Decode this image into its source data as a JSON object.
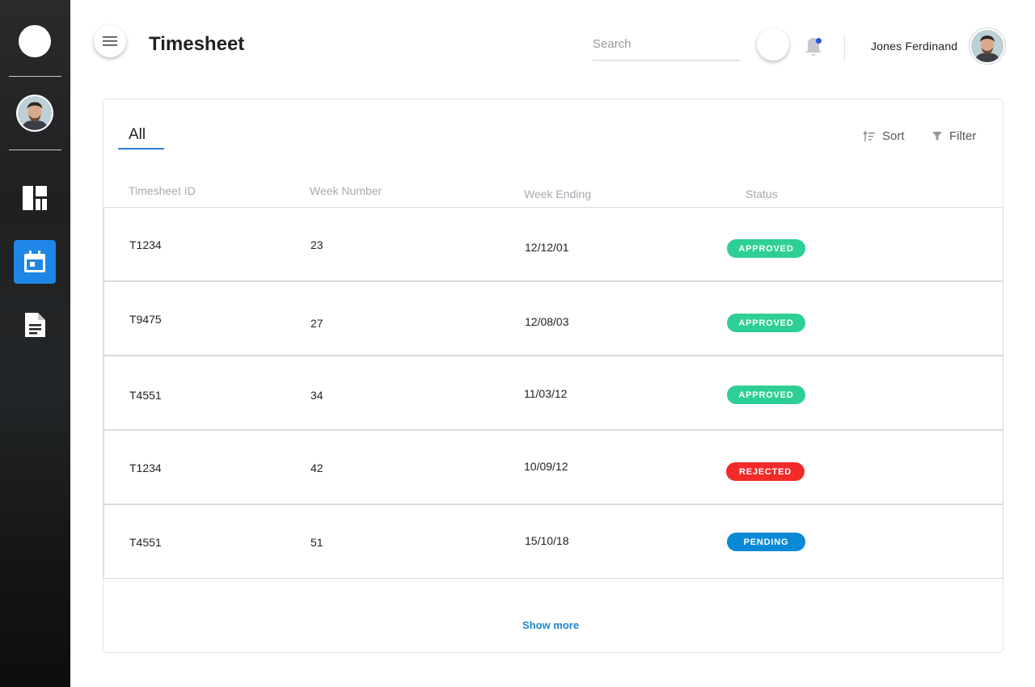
{
  "header": {
    "title": "Timesheet",
    "search_placeholder": "Search",
    "user_name": "Jones Ferdinand"
  },
  "sidebar": {
    "items": [
      {
        "icon": "dashboard-icon",
        "active": false
      },
      {
        "icon": "calendar-icon",
        "active": true
      },
      {
        "icon": "document-icon",
        "active": false
      }
    ]
  },
  "tabs": [
    {
      "label": "All",
      "active": true
    }
  ],
  "toolbar": {
    "sort_label": "Sort",
    "filter_label": "Filter"
  },
  "table": {
    "columns": [
      "Timesheet ID",
      "Week Number",
      "Week Ending",
      "Status"
    ],
    "rows": [
      {
        "id": "T1234",
        "week": "23",
        "ending": "12/12/01",
        "status": "APPROVED"
      },
      {
        "id": "T9475",
        "week": "27",
        "ending": "12/08/03",
        "status": "APPROVED"
      },
      {
        "id": "T4551",
        "week": "34",
        "ending": "11/03/12",
        "status": "APPROVED"
      },
      {
        "id": "T1234",
        "week": "42",
        "ending": "10/09/12",
        "status": "REJECTED"
      },
      {
        "id": "T4551",
        "week": "51",
        "ending": "15/10/18",
        "status": "PENDING"
      }
    ]
  },
  "show_more": "Show more",
  "colors": {
    "accent": "#1e86e6",
    "approved": "#2ecf94",
    "rejected": "#f22a2a",
    "pending": "#0a8ad6"
  }
}
